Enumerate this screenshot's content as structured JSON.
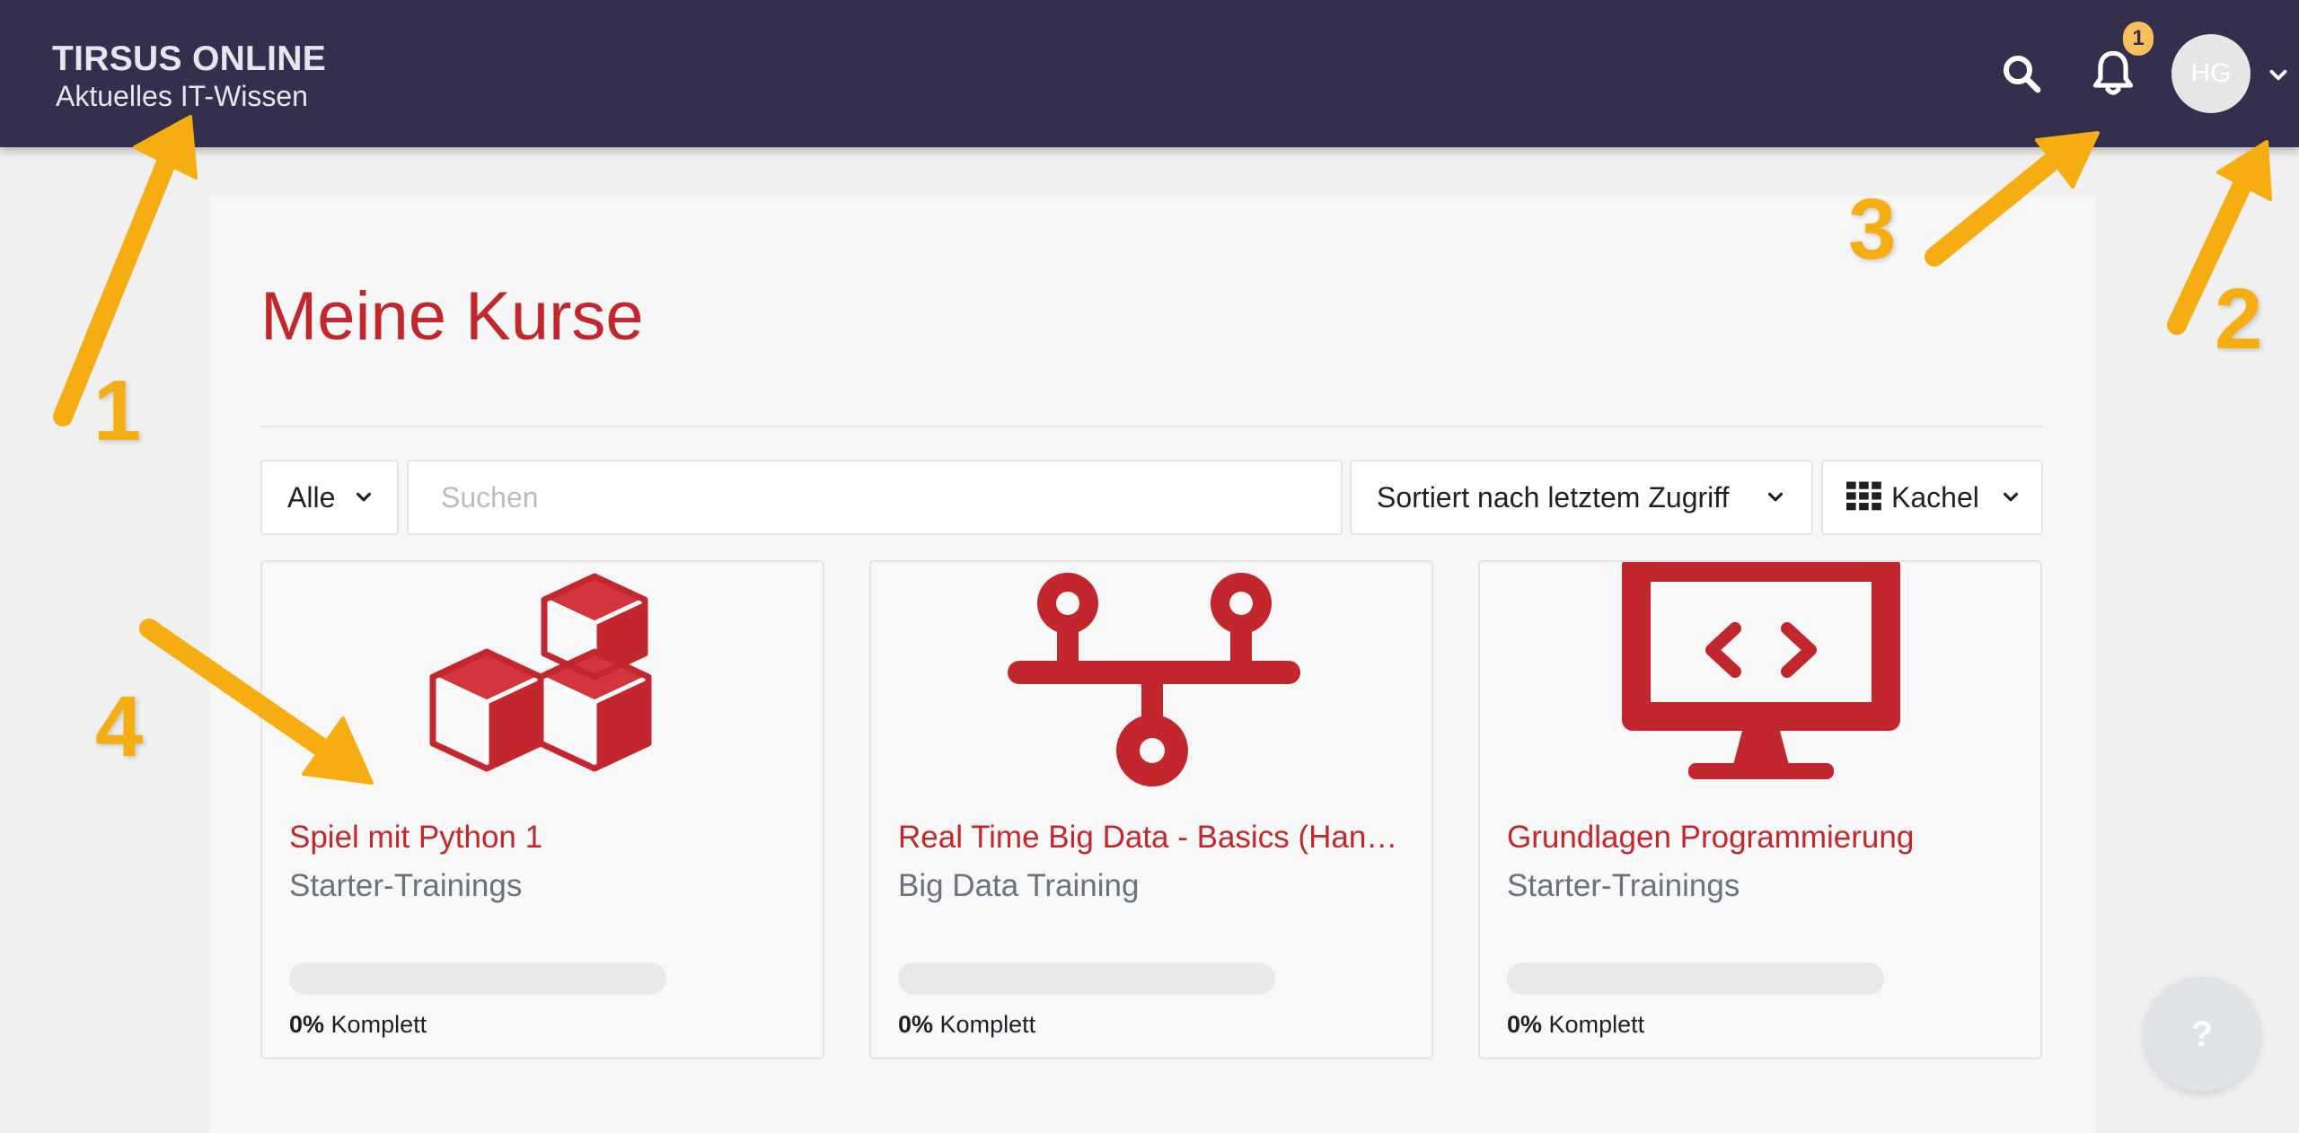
{
  "header": {
    "brand_title": "TIRSUS ONLINE",
    "brand_subtitle": "Aktuelles IT-Wissen",
    "notification_count": "1",
    "user_initials": "HG",
    "icons": {
      "search": "search-icon",
      "notifications": "bell-icon",
      "user_menu": "chevron-down-icon"
    }
  },
  "page": {
    "title": "Meine Kurse"
  },
  "controls": {
    "filter_label": "Alle",
    "search_placeholder": "Suchen",
    "sort_label": "Sortiert nach letztem Zugriff",
    "view_label": "Kachel",
    "view_icon": "grid-icon"
  },
  "courses": [
    {
      "title": "Spiel mit Python 1",
      "category": "Starter-Trainings",
      "progress_percent": "0%",
      "progress_label": "Komplett",
      "icon": "cubes-icon"
    },
    {
      "title": "Real Time Big Data - Basics (Hands on)",
      "category": "Big Data Training",
      "progress_percent": "0%",
      "progress_label": "Komplett",
      "icon": "network-icon"
    },
    {
      "title": "Grundlagen Programmierung",
      "category": "Starter-Trainings",
      "progress_percent": "0%",
      "progress_label": "Komplett",
      "icon": "monitor-code-icon"
    }
  ],
  "help_button": {
    "label": "?"
  },
  "annotations": [
    "1",
    "2",
    "3",
    "4"
  ],
  "colors": {
    "navbar": "#352f4d",
    "accent": "#c1272d",
    "annotation": "#f6ad12",
    "badge": "#f6c15d"
  }
}
